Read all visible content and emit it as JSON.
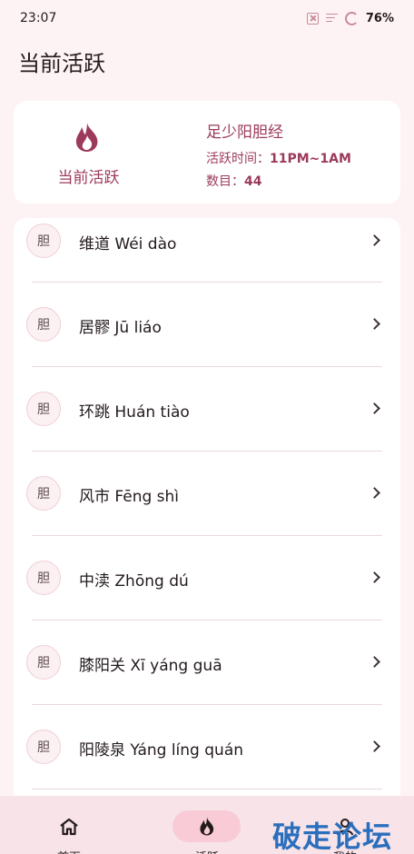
{
  "status_bar": {
    "time": "23:07",
    "battery": "76%",
    "icons": [
      "close-box-icon",
      "notification-lines-icon",
      "battery-ring-icon"
    ]
  },
  "page_title": "当前活跃",
  "active_card": {
    "label": "当前活跃",
    "icon": "flame-icon",
    "meridian": "足少阳胆经",
    "time_label": "活跃时间：",
    "time_value": "11PM~1AM",
    "count_label": "数目：",
    "count_value": "44"
  },
  "points": [
    {
      "badge": "胆",
      "name": "维道 Wéi dào"
    },
    {
      "badge": "胆",
      "name": "居髎 Jū liáo"
    },
    {
      "badge": "胆",
      "name": "环跳 Huán tiào"
    },
    {
      "badge": "胆",
      "name": "风市 Fēng shì"
    },
    {
      "badge": "胆",
      "name": "中渎 Zhōng dú"
    },
    {
      "badge": "胆",
      "name": "膝阳关 Xī yáng guā"
    },
    {
      "badge": "胆",
      "name": "阳陵泉 Yáng líng quán"
    }
  ],
  "bottom_nav": {
    "items": [
      {
        "label": "首页",
        "icon": "home-icon",
        "active": false
      },
      {
        "label": "活跃",
        "icon": "flame-icon",
        "active": true
      },
      {
        "label": "我的",
        "icon": "user-icon",
        "active": false
      }
    ]
  },
  "watermark": "破走论坛",
  "colors": {
    "accent": "#9c3a5b",
    "background": "#fdf3f5",
    "nav_background": "#f7e3e8",
    "nav_active_pill": "#f9cbd7",
    "watermark": "#2a6fbd"
  }
}
